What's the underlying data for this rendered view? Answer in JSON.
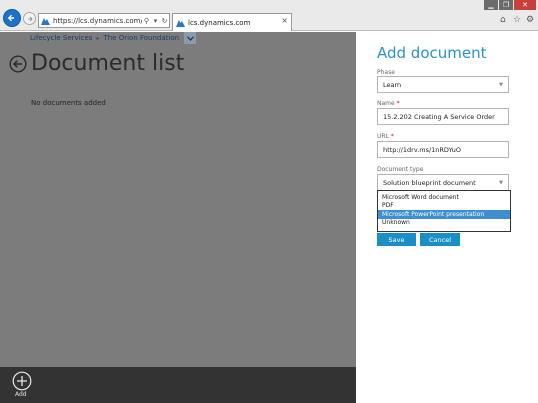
{
  "browser": {
    "address_url": "https://lcs.dynamics.com/Docum",
    "tab_title": "lcs.dynamics.com",
    "icons": [
      "back-icon",
      "forward-icon",
      "search-icon",
      "refresh-icon",
      "close-icon",
      "home-icon",
      "star-icon",
      "gear-icon"
    ]
  },
  "app": {
    "breadcrumb": {
      "root": "Lifecycle Services",
      "project": "The Orion Foundation"
    },
    "page_title": "Document list",
    "empty_message": "No documents added",
    "bottom_bar": {
      "add_label": "Add"
    }
  },
  "panel": {
    "title": "Add document",
    "phase": {
      "label": "Phase",
      "value": "Learn"
    },
    "name": {
      "label": "Name",
      "value": "15.2.202 Creating A Service Order",
      "required_mark": "*"
    },
    "url": {
      "label": "URL",
      "value": "http://1drv.ms/1nRDYuO",
      "required_mark": "*"
    },
    "document_type": {
      "label": "Document type",
      "value": "Solution blueprint document",
      "options": [
        "Microsoft Word document",
        "PDF",
        "Microsoft PowerPoint presentation",
        "Unknown"
      ],
      "highlighted_index": 2
    },
    "save_label": "Save",
    "cancel_label": "Cancel"
  },
  "colors": {
    "accent": "#2a94c8",
    "button": "#1a8ec7",
    "overlay": "#7c7c7c",
    "bottom_bar": "#333333",
    "highlight": "#3d8fd1"
  }
}
